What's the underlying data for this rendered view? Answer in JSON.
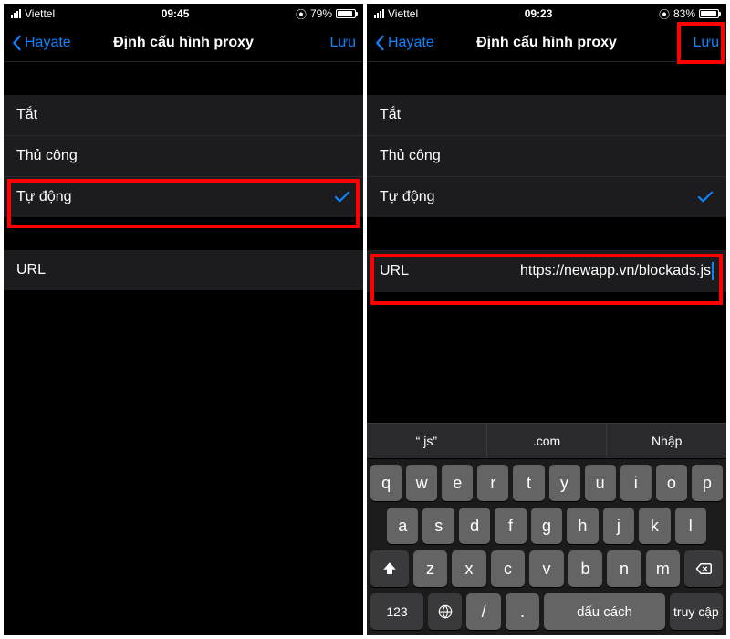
{
  "left": {
    "status": {
      "carrier": "Viettel",
      "time": "09:45",
      "battery_pct": "79%",
      "battery_fill": 79
    },
    "nav": {
      "back": "Hayate",
      "title": "Định cấu hình proxy",
      "save": "Lưu"
    },
    "options": {
      "off": "Tắt",
      "manual": "Thủ công",
      "auto": "Tự động"
    },
    "url_label": "URL",
    "url_value": ""
  },
  "right": {
    "status": {
      "carrier": "Viettel",
      "time": "09:23",
      "battery_pct": "83%",
      "battery_fill": 83
    },
    "nav": {
      "back": "Hayate",
      "title": "Định cấu hình proxy",
      "save": "Lưu"
    },
    "options": {
      "off": "Tắt",
      "manual": "Thủ công",
      "auto": "Tự động"
    },
    "url_label": "URL",
    "url_value": "https://newapp.vn/blockads.js",
    "shortcuts": {
      "a": "“.js”",
      "b": ".com",
      "c": "Nhập"
    },
    "keys": {
      "r1": [
        "q",
        "w",
        "e",
        "r",
        "t",
        "y",
        "u",
        "i",
        "o",
        "p"
      ],
      "r2": [
        "a",
        "s",
        "d",
        "f",
        "g",
        "h",
        "j",
        "k",
        "l"
      ],
      "r3": [
        "z",
        "x",
        "c",
        "v",
        "b",
        "n",
        "m"
      ],
      "num": "123",
      "slash": "/",
      "dot": ".",
      "space": "dấu cách",
      "go": "truy cập"
    }
  }
}
